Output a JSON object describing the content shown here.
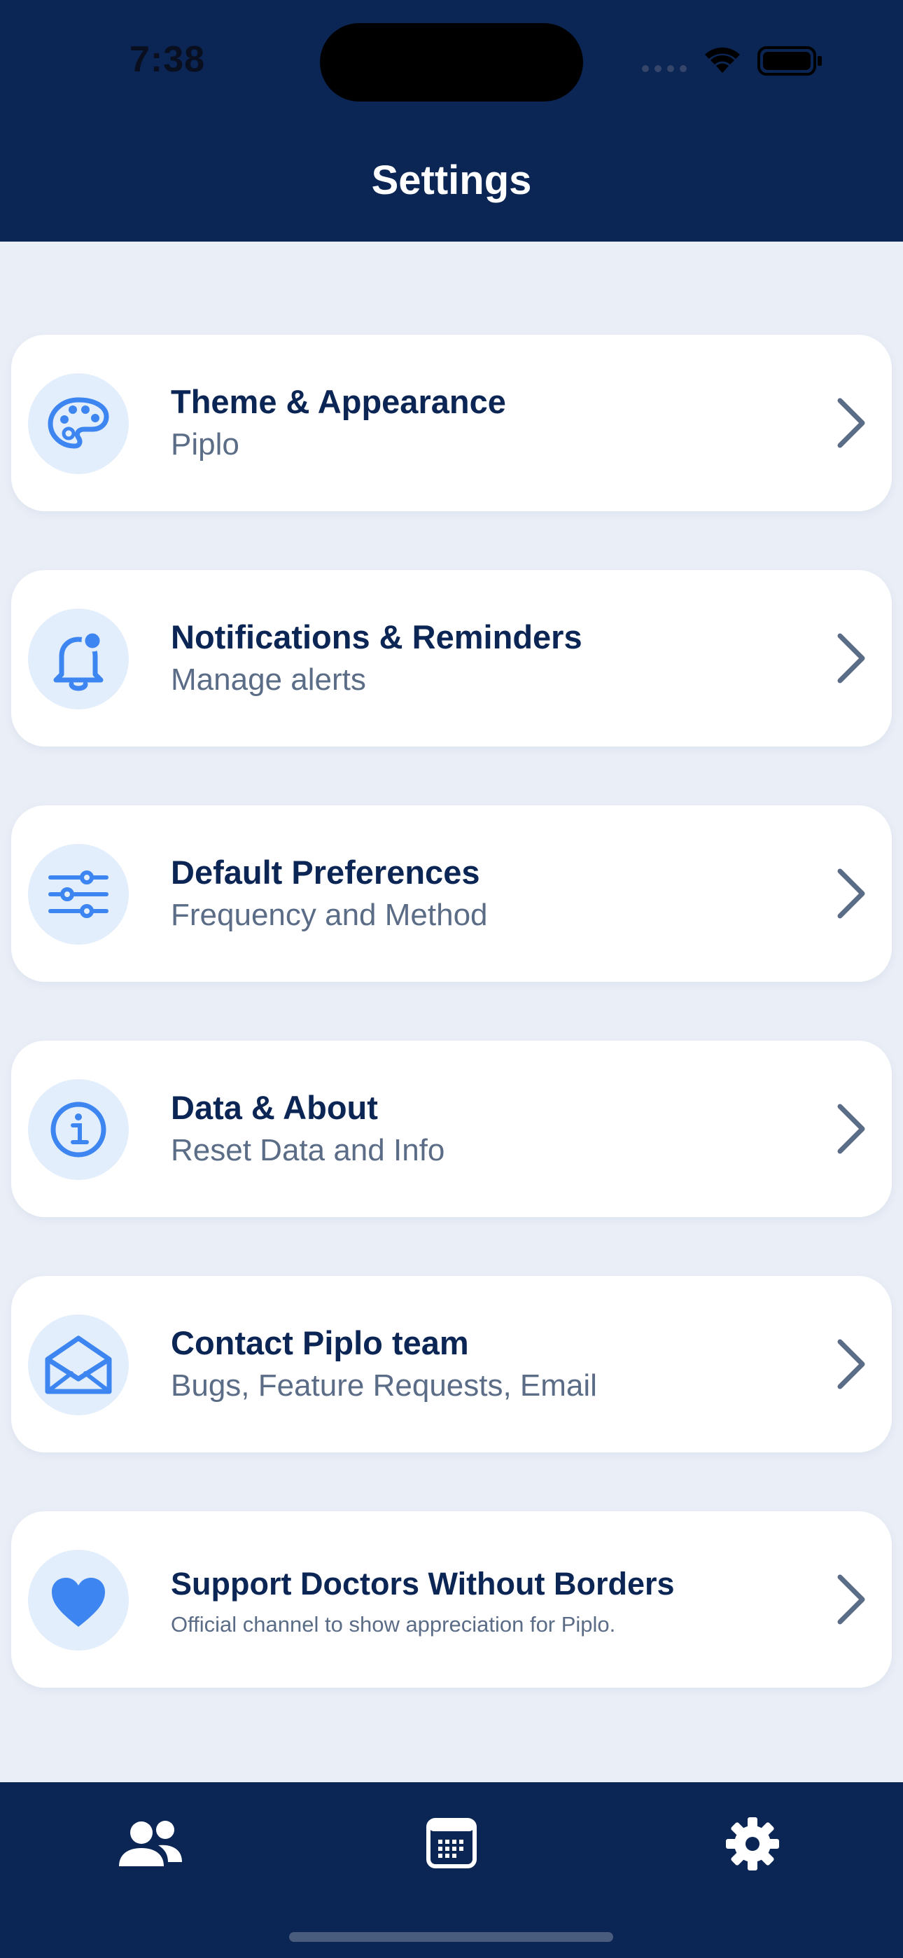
{
  "status_bar": {
    "time": "7:38"
  },
  "header": {
    "title": "Settings"
  },
  "settings": [
    {
      "title": "Theme & Appearance",
      "subtitle": "Piplo",
      "icon": "palette-icon"
    },
    {
      "title": "Notifications & Reminders",
      "subtitle": "Manage alerts",
      "icon": "bell-icon"
    },
    {
      "title": "Default Preferences",
      "subtitle": "Frequency and Method",
      "icon": "sliders-icon"
    },
    {
      "title": "Data & About",
      "subtitle": "Reset Data and Info",
      "icon": "info-icon"
    },
    {
      "title": "Contact Piplo team",
      "subtitle": "Bugs, Feature Requests, Email",
      "icon": "envelope-icon"
    },
    {
      "title": "Support Doctors Without Borders",
      "subtitle": "Official channel to show appreciation for Piplo.",
      "icon": "heart-icon"
    }
  ],
  "tab_bar": {
    "tabs": [
      {
        "icon": "people-icon",
        "selected": false
      },
      {
        "icon": "calendar-icon",
        "selected": false
      },
      {
        "icon": "gear-icon",
        "selected": true
      }
    ]
  },
  "colors": {
    "header_bg": "#0B2554",
    "page_bg": "#E9EEF7",
    "card_bg": "#FFFFFF",
    "accent": "#3D85F0",
    "icon_circle": "#E3EEFC",
    "title_text": "#0B2554",
    "subtitle_text": "#5B6C87"
  }
}
